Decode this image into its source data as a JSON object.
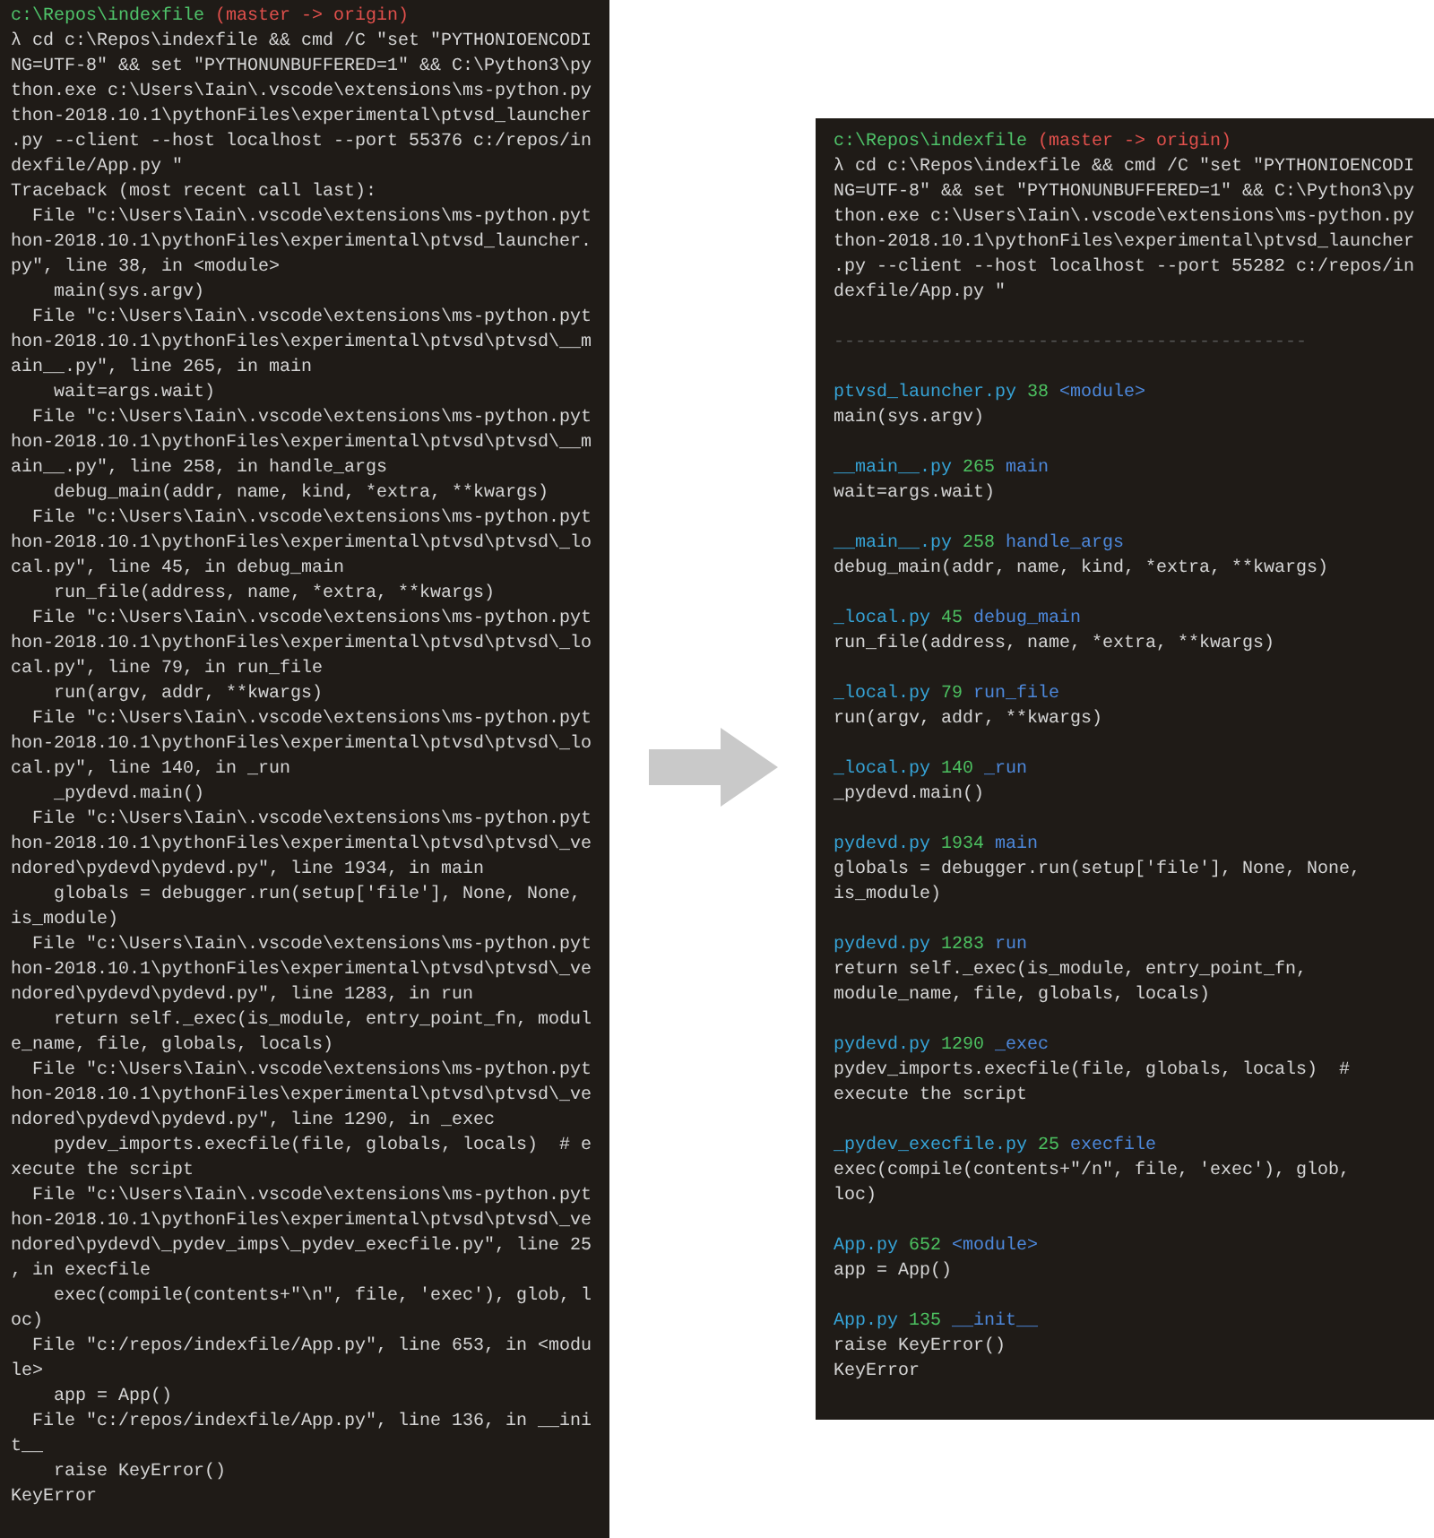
{
  "left_terminal": {
    "prompt": {
      "path": "c:\\Repos\\indexfile",
      "branch": "(master -> origin)"
    },
    "command_lines": [
      "λ cd c:\\Repos\\indexfile && cmd /C \"set \"PYTHONIOENCODI",
      "NG=UTF-8\" && set \"PYTHONUNBUFFERED=1\" && C:\\Python3\\py",
      "thon.exe c:\\Users\\Iain\\.vscode\\extensions\\ms-python.py",
      "thon-2018.10.1\\pythonFiles\\experimental\\ptvsd_launcher",
      ".py --client --host localhost --port 55376 c:/repos/in",
      "dexfile/App.py \""
    ],
    "output_lines": [
      "Traceback (most recent call last):",
      "  File \"c:\\Users\\Iain\\.vscode\\extensions\\ms-python.pyt",
      "hon-2018.10.1\\pythonFiles\\experimental\\ptvsd_launcher.",
      "py\", line 38, in <module>",
      "    main(sys.argv)",
      "  File \"c:\\Users\\Iain\\.vscode\\extensions\\ms-python.pyt",
      "hon-2018.10.1\\pythonFiles\\experimental\\ptvsd\\ptvsd\\__m",
      "ain__.py\", line 265, in main",
      "    wait=args.wait)",
      "  File \"c:\\Users\\Iain\\.vscode\\extensions\\ms-python.pyt",
      "hon-2018.10.1\\pythonFiles\\experimental\\ptvsd\\ptvsd\\__m",
      "ain__.py\", line 258, in handle_args",
      "    debug_main(addr, name, kind, *extra, **kwargs)",
      "  File \"c:\\Users\\Iain\\.vscode\\extensions\\ms-python.pyt",
      "hon-2018.10.1\\pythonFiles\\experimental\\ptvsd\\ptvsd\\_lo",
      "cal.py\", line 45, in debug_main",
      "    run_file(address, name, *extra, **kwargs)",
      "  File \"c:\\Users\\Iain\\.vscode\\extensions\\ms-python.pyt",
      "hon-2018.10.1\\pythonFiles\\experimental\\ptvsd\\ptvsd\\_lo",
      "cal.py\", line 79, in run_file",
      "    run(argv, addr, **kwargs)",
      "  File \"c:\\Users\\Iain\\.vscode\\extensions\\ms-python.pyt",
      "hon-2018.10.1\\pythonFiles\\experimental\\ptvsd\\ptvsd\\_lo",
      "cal.py\", line 140, in _run",
      "    _pydevd.main()",
      "  File \"c:\\Users\\Iain\\.vscode\\extensions\\ms-python.pyt",
      "hon-2018.10.1\\pythonFiles\\experimental\\ptvsd\\ptvsd\\_ve",
      "ndored\\pydevd\\pydevd.py\", line 1934, in main",
      "    globals = debugger.run(setup['file'], None, None,",
      "is_module)",
      "  File \"c:\\Users\\Iain\\.vscode\\extensions\\ms-python.pyt",
      "hon-2018.10.1\\pythonFiles\\experimental\\ptvsd\\ptvsd\\_ve",
      "ndored\\pydevd\\pydevd.py\", line 1283, in run",
      "    return self._exec(is_module, entry_point_fn, modul",
      "e_name, file, globals, locals)",
      "  File \"c:\\Users\\Iain\\.vscode\\extensions\\ms-python.pyt",
      "hon-2018.10.1\\pythonFiles\\experimental\\ptvsd\\ptvsd\\_ve",
      "ndored\\pydevd\\pydevd.py\", line 1290, in _exec",
      "    pydev_imports.execfile(file, globals, locals)  # e",
      "xecute the script",
      "  File \"c:\\Users\\Iain\\.vscode\\extensions\\ms-python.pyt",
      "hon-2018.10.1\\pythonFiles\\experimental\\ptvsd\\ptvsd\\_ve",
      "ndored\\pydevd\\_pydev_imps\\_pydev_execfile.py\", line 25",
      ", in execfile",
      "    exec(compile(contents+\"\\n\", file, 'exec'), glob, l",
      "oc)",
      "  File \"c:/repos/indexfile/App.py\", line 653, in <modu",
      "le>",
      "    app = App()",
      "  File \"c:/repos/indexfile/App.py\", line 136, in __ini",
      "t__",
      "    raise KeyError()",
      "KeyError"
    ]
  },
  "right_terminal": {
    "prompt": {
      "path": "c:\\Repos\\indexfile",
      "branch": "(master -> origin)"
    },
    "command_lines": [
      "λ cd c:\\Repos\\indexfile && cmd /C \"set \"PYTHONIOENCODI",
      "NG=UTF-8\" && set \"PYTHONUNBUFFERED=1\" && C:\\Python3\\py",
      "thon.exe c:\\Users\\Iain\\.vscode\\extensions\\ms-python.py",
      "thon-2018.10.1\\pythonFiles\\experimental\\ptvsd_launcher",
      ".py --client --host localhost --port 55282 c:/repos/in",
      "dexfile/App.py \""
    ],
    "separator": "--------------------------------------------",
    "frames": [
      {
        "file": "ptvsd_launcher.py",
        "line": "38",
        "func": "<module>",
        "code": [
          "main(sys.argv)"
        ]
      },
      {
        "file": "__main__.py",
        "line": "265",
        "func": "main",
        "code": [
          "wait=args.wait)"
        ]
      },
      {
        "file": "__main__.py",
        "line": "258",
        "func": "handle_args",
        "code": [
          "debug_main(addr, name, kind, *extra, **kwargs)"
        ]
      },
      {
        "file": "_local.py",
        "line": "45",
        "func": "debug_main",
        "code": [
          "run_file(address, name, *extra, **kwargs)"
        ]
      },
      {
        "file": "_local.py",
        "line": "79",
        "func": "run_file",
        "code": [
          "run(argv, addr, **kwargs)"
        ]
      },
      {
        "file": "_local.py",
        "line": "140",
        "func": "_run",
        "code": [
          "_pydevd.main()"
        ]
      },
      {
        "file": "pydevd.py",
        "line": "1934",
        "func": "main",
        "code": [
          "globals = debugger.run(setup['file'], None, None,",
          "is_module)"
        ]
      },
      {
        "file": "pydevd.py",
        "line": "1283",
        "func": "run",
        "code": [
          "return self._exec(is_module, entry_point_fn,",
          "module_name, file, globals, locals)"
        ]
      },
      {
        "file": "pydevd.py",
        "line": "1290",
        "func": "_exec",
        "code": [
          "pydev_imports.execfile(file, globals, locals)  #",
          "execute the script"
        ]
      },
      {
        "file": "_pydev_execfile.py",
        "line": "25",
        "func": "execfile",
        "code": [
          "exec(compile(contents+\"/n\", file, 'exec'), glob,",
          "loc)"
        ]
      },
      {
        "file": "App.py",
        "line": "652",
        "func": "<module>",
        "code": [
          "app = App()"
        ]
      },
      {
        "file": "App.py",
        "line": "135",
        "func": "__init__",
        "code": [
          "raise KeyError()"
        ]
      }
    ],
    "error": "KeyError"
  }
}
